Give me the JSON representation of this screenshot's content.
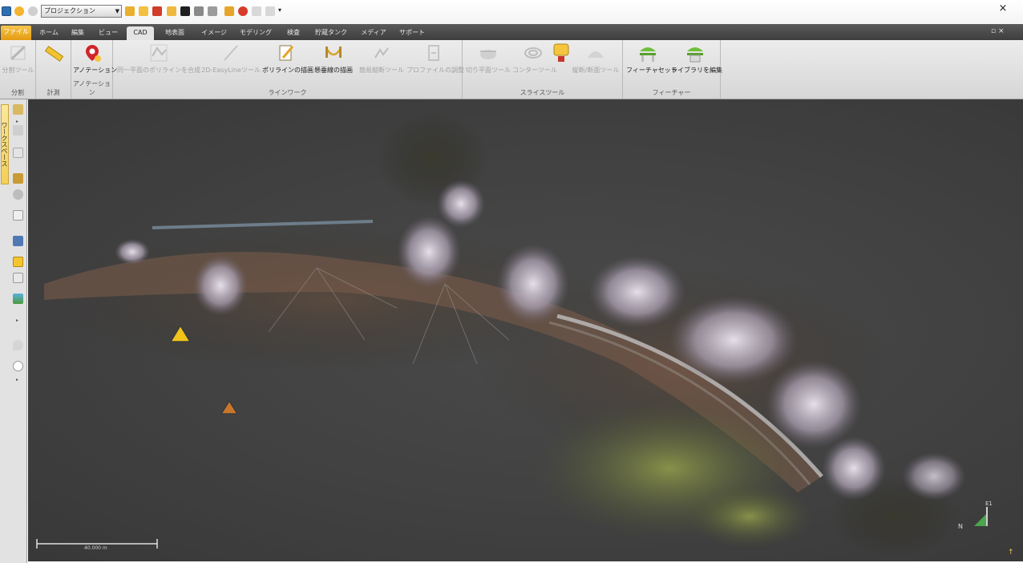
{
  "quick_access": {
    "project_combo": "プロジェクション",
    "icons": [
      "app-icon",
      "undo-icon",
      "redo-icon",
      "open-folder-icon",
      "new-file-icon",
      "import-icon",
      "export-icon",
      "save-icon",
      "print-icon",
      "layers-icon",
      "pencil-icon",
      "annotation-icon",
      "markup-icon",
      "screenshot-icon",
      "customize-icon"
    ]
  },
  "window": {
    "close_glyph": "×",
    "restore_glyph": "▫ ⨯"
  },
  "tabs": [
    {
      "label": "ファイル",
      "kind": "file"
    },
    {
      "label": "ホーム"
    },
    {
      "label": "編集"
    },
    {
      "label": "ビュー"
    },
    {
      "label": "CAD",
      "active": true
    },
    {
      "label": "地表面"
    },
    {
      "label": "イメージ"
    },
    {
      "label": "モデリング"
    },
    {
      "label": "検査"
    },
    {
      "label": "貯蔵タンク"
    },
    {
      "label": "メディア"
    },
    {
      "label": "サポート"
    }
  ],
  "ribbon": {
    "groups": [
      {
        "label": "分割",
        "buttons": [
          {
            "label": "分割ツール",
            "icon": "split-tool-icon",
            "disabled": true
          }
        ]
      },
      {
        "label": "計測",
        "buttons": [
          {
            "label": "",
            "icon": "ruler-icon"
          }
        ]
      },
      {
        "label": "アノテーション",
        "buttons": [
          {
            "label": "アノテーション",
            "icon": "annotation-pin-icon"
          }
        ]
      },
      {
        "label": "ラインワーク",
        "buttons": [
          {
            "label": "同一平面のポリラインを合成",
            "icon": "merge-polyline-icon",
            "disabled": true
          },
          {
            "label": "2D-EasyLineツール",
            "icon": "easyline-icon",
            "disabled": true
          },
          {
            "label": "ポリラインの描画",
            "icon": "draw-polyline-icon"
          },
          {
            "label": "懸垂線の描画",
            "icon": "catenary-icon"
          },
          {
            "label": "簡易縦断ツール",
            "icon": "profile-tool-icon",
            "disabled": true
          },
          {
            "label": "プロファイルの調整",
            "icon": "profile-adjust-icon",
            "disabled": true
          }
        ]
      },
      {
        "label": "スライスツール",
        "buttons": [
          {
            "label": "切り平面ツール",
            "icon": "cut-plane-icon",
            "disabled": true
          },
          {
            "label": "コンターツール",
            "icon": "contour-icon",
            "disabled": true
          },
          {
            "label": "",
            "icon": "slice-box-icon"
          },
          {
            "label": "縦断/断面ツール",
            "icon": "section-tool-icon",
            "disabled": true
          }
        ]
      },
      {
        "label": "フィーチャー",
        "buttons": [
          {
            "label": "フィーチャセット",
            "icon": "feature-set-icon"
          },
          {
            "label": "ライブラリを編集",
            "icon": "edit-library-icon"
          }
        ]
      }
    ]
  },
  "workspace": {
    "tab_label": "ワークスペース"
  },
  "viewport": {
    "scale_bar_label": "40.000 m",
    "axis_n": "N",
    "axis_e": "E1",
    "background": "#444444"
  },
  "colors": {
    "file_tab": "#f0a82a",
    "ribbon_bg": "#e3e3e3",
    "tabstrip_bg": "#4a4a4a"
  }
}
